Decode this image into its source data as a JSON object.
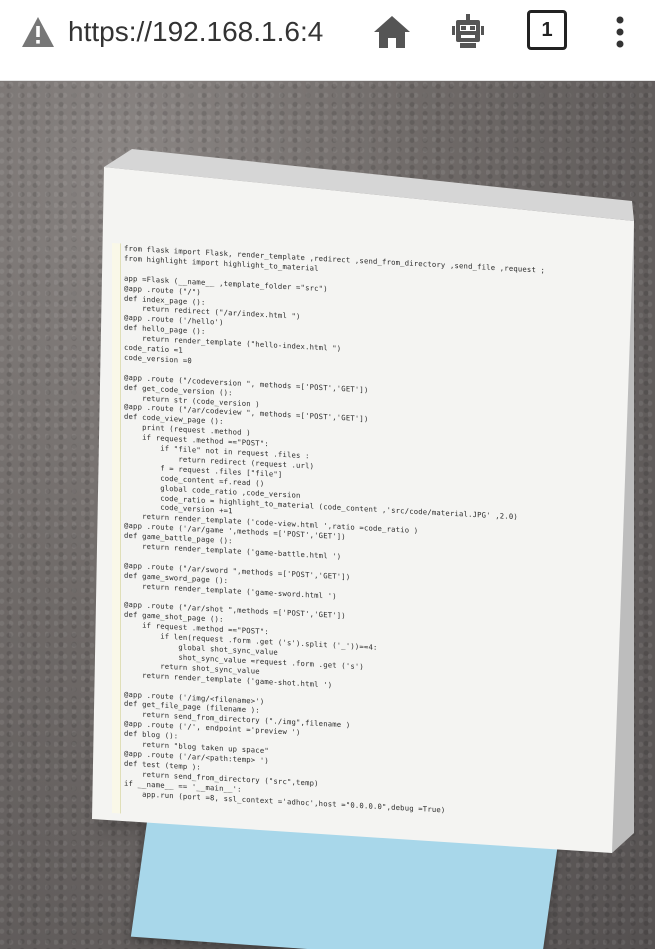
{
  "browser": {
    "url": "https://192.168.1.6:4",
    "tab_count": "1",
    "icons": [
      "warning-icon",
      "home-icon",
      "robot-icon",
      "tabs-icon",
      "more-icon"
    ]
  },
  "code_lines": [
    "from flask import Flask, render_template ,redirect ,send_from_directory ,send_file ,request ;",
    "from highlight import highlight_to_material",
    "",
    "app =Flask (__name__ ,template_folder =\"src\")",
    "@app .route (\"/\")",
    "def index_page ():",
    "    return redirect (\"/ar/index.html \")",
    "@app .route ('/hello')",
    "def hello_page ():",
    "    return render_template (\"hello-index.html \")",
    "code_ratio =1",
    "code_version =0",
    "",
    "@app .route (\"/codeversion \", methods =['POST','GET'])",
    "def get_code_version ():",
    "    return str (code_version )",
    "@app .route (\"/ar/codeview \", methods =['POST','GET'])",
    "def code_view_page ():",
    "    print (request .method )",
    "    if request .method ==\"POST\":",
    "        if \"file\" not in request .files :",
    "            return redirect (request .url)",
    "        f = request .files [\"file\"]",
    "        code_content =f.read ()",
    "        global code_ratio ,code_version",
    "        code_ratio = highlight_to_material (code_content ,'src/code/material.JPG' ,2.0)",
    "        code_version +=1",
    "    return render_template ('code-view.html ',ratio =code_ratio )",
    "@app .route ('/ar/game ',methods =['POST','GET'])",
    "def game_battle_page ():",
    "    return render_template ('game-battle.html ')",
    "",
    "@app .route (\"/ar/sword \",methods =['POST','GET'])",
    "def game_sword_page ():",
    "    return render_template ('game-sword.html ')",
    "",
    "@app .route (\"/ar/shot \",methods =['POST','GET'])",
    "def game_shot_page ():",
    "    if request .method ==\"POST\":",
    "        if len(request .form .get ('s').split ('_'))==4:",
    "            global shot_sync_value",
    "            shot_sync_value =request .form .get ('s')",
    "        return shot_sync_value",
    "    return render_template ('game-shot.html ')",
    "",
    "@app .route ('/img/<filename>')",
    "def get_file_page (filename ):",
    "    return send_from_directory (\"./img\",filename )",
    "@app .route ('/', endpoint ='preview ')",
    "def blog ():",
    "    return \"blog taken up space\"",
    "@app .route ('/ar/<path:temp> ')",
    "def test (temp ):",
    "    return send_from_directory (\"src\",temp)",
    "if __name__ == '__main__':",
    "    app.run (port =8, ssl_context ='adhoc',host =\"0.0.0.0\",debug =True)"
  ]
}
